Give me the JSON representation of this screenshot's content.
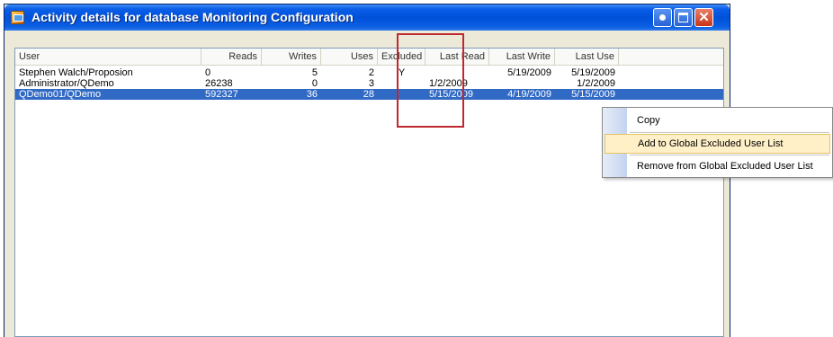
{
  "window": {
    "title": "Activity details for database Monitoring Configuration",
    "icon": "database-activity-icon",
    "controls": [
      "help-icon",
      "maximize-icon",
      "close-icon"
    ]
  },
  "table": {
    "columns": [
      "User",
      "Reads",
      "Writes",
      "Uses",
      "Excluded",
      "Last Read",
      "Last Write",
      "Last Use"
    ],
    "rows": [
      {
        "user": "Stephen Walch/Proposion",
        "reads": "0",
        "writes": "5",
        "uses": "2",
        "excluded": "Y",
        "last_read": "",
        "last_write": "5/19/2009",
        "last_use": "5/19/2009",
        "selected": false
      },
      {
        "user": "Administrator/QDemo",
        "reads": "26238",
        "writes": "0",
        "uses": "3",
        "excluded": "",
        "last_read": "1/2/2009",
        "last_write": "",
        "last_use": "1/2/2009",
        "selected": false
      },
      {
        "user": "QDemo01/QDemo",
        "reads": "592327",
        "writes": "36",
        "uses": "28",
        "excluded": "",
        "last_read": "5/15/2009",
        "last_write": "4/19/2009",
        "last_use": "5/15/2009",
        "selected": true
      }
    ],
    "selection_color": "#316ac5"
  },
  "context_menu": {
    "items": [
      {
        "label": "Copy",
        "highlighted": false
      },
      {
        "label": "Add to Global Excluded User List",
        "highlighted": true
      },
      {
        "label": "Remove from Global Excluded User List",
        "highlighted": false
      }
    ],
    "highlight_color": "#fff0c8"
  },
  "annotation": {
    "color": "#c0282f"
  }
}
